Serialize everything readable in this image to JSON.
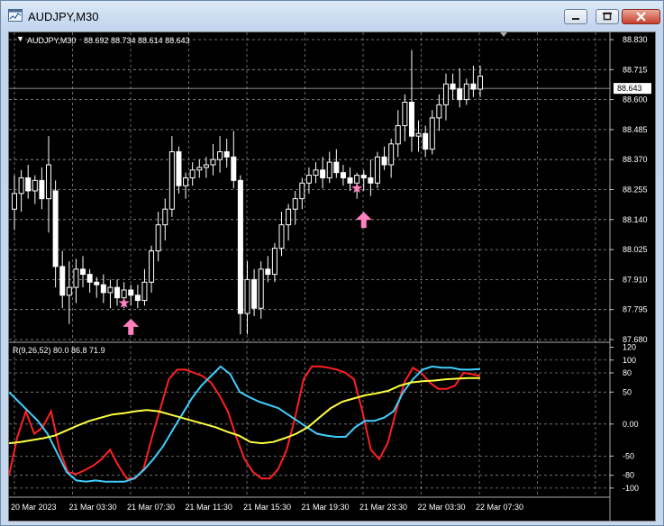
{
  "window": {
    "title": "AUDJPY,M30",
    "icon": "chart-window-icon"
  },
  "controls": {
    "minimize": "minimize-icon",
    "maximize": "maximize-icon",
    "close": "close-icon"
  },
  "chart": {
    "symbol_label": "AUDJPY,M30",
    "ohlc_text": "88.692 88.734 88.614 88.643",
    "current_price": "88.643",
    "price_ticks": [
      "88.830",
      "88.715",
      "88.600",
      "88.485",
      "88.370",
      "88.255",
      "88.140",
      "88.025",
      "87.910",
      "87.795",
      "87.680"
    ],
    "indicator_label": "R(9,26,52) 80.0 86.8 71.9",
    "indicator_ticks": [
      "120",
      "100",
      "80",
      "50",
      "0.00",
      "-50",
      "-80",
      "-100"
    ],
    "time_labels": [
      "20 Mar 2023",
      "21 Mar 03:30",
      "21 Mar 07:30",
      "21 Mar 11:30",
      "21 Mar 15:30",
      "21 Mar 19:30",
      "21 Mar 23:30",
      "22 Mar 03:30",
      "22 Mar 07:30"
    ],
    "colors": {
      "background": "#000000",
      "grid": "#c8c8c8",
      "candle": "#ffffff",
      "candle_body_bull": "#000000",
      "marker": "#ff7fbf",
      "fast_line": "#ff2020",
      "mid_line": "#40d0ff",
      "slow_line": "#ffff40",
      "axis_text": "#ffffff",
      "price_box_bg": "#ffffff",
      "price_box_text": "#000000"
    }
  },
  "chart_data": {
    "type": "candlestick",
    "price_axis_range": [
      87.68,
      88.83
    ],
    "candles": [
      {
        "o": 88.18,
        "h": 88.31,
        "l": 88.1,
        "c": 88.24
      },
      {
        "o": 88.24,
        "h": 88.33,
        "l": 88.17,
        "c": 88.3
      },
      {
        "o": 88.3,
        "h": 88.35,
        "l": 88.22,
        "c": 88.25
      },
      {
        "o": 88.25,
        "h": 88.31,
        "l": 88.2,
        "c": 88.29
      },
      {
        "o": 88.29,
        "h": 88.34,
        "l": 88.18,
        "c": 88.22
      },
      {
        "o": 88.22,
        "h": 88.46,
        "l": 88.09,
        "c": 88.35
      },
      {
        "o": 88.25,
        "h": 88.29,
        "l": 87.88,
        "c": 87.96
      },
      {
        "o": 87.96,
        "h": 88.02,
        "l": 87.8,
        "c": 87.85
      },
      {
        "o": 87.85,
        "h": 87.98,
        "l": 87.74,
        "c": 87.88
      },
      {
        "o": 87.88,
        "h": 87.99,
        "l": 87.82,
        "c": 87.95
      },
      {
        "o": 87.95,
        "h": 88.0,
        "l": 87.88,
        "c": 87.93
      },
      {
        "o": 87.93,
        "h": 87.95,
        "l": 87.86,
        "c": 87.9
      },
      {
        "o": 87.9,
        "h": 87.92,
        "l": 87.84,
        "c": 87.89
      },
      {
        "o": 87.89,
        "h": 87.93,
        "l": 87.82,
        "c": 87.86
      },
      {
        "o": 87.86,
        "h": 87.91,
        "l": 87.8,
        "c": 87.88
      },
      {
        "o": 87.88,
        "h": 87.91,
        "l": 87.81,
        "c": 87.84
      },
      {
        "o": 87.84,
        "h": 87.9,
        "l": 87.8,
        "c": 87.87
      },
      {
        "o": 87.87,
        "h": 87.89,
        "l": 87.81,
        "c": 87.85
      },
      {
        "o": 87.85,
        "h": 87.89,
        "l": 87.8,
        "c": 87.83
      },
      {
        "o": 87.83,
        "h": 87.95,
        "l": 87.81,
        "c": 87.9
      },
      {
        "o": 87.9,
        "h": 88.04,
        "l": 87.86,
        "c": 88.02
      },
      {
        "o": 88.02,
        "h": 88.17,
        "l": 87.98,
        "c": 88.12
      },
      {
        "o": 88.12,
        "h": 88.22,
        "l": 88.06,
        "c": 88.18
      },
      {
        "o": 88.18,
        "h": 88.46,
        "l": 88.15,
        "c": 88.4
      },
      {
        "o": 88.4,
        "h": 88.42,
        "l": 88.24,
        "c": 88.27
      },
      {
        "o": 88.27,
        "h": 88.32,
        "l": 88.22,
        "c": 88.3
      },
      {
        "o": 88.3,
        "h": 88.36,
        "l": 88.27,
        "c": 88.33
      },
      {
        "o": 88.33,
        "h": 88.37,
        "l": 88.3,
        "c": 88.34
      },
      {
        "o": 88.34,
        "h": 88.38,
        "l": 88.3,
        "c": 88.35
      },
      {
        "o": 88.35,
        "h": 88.43,
        "l": 88.31,
        "c": 88.37
      },
      {
        "o": 88.37,
        "h": 88.46,
        "l": 88.32,
        "c": 88.4
      },
      {
        "o": 88.4,
        "h": 88.45,
        "l": 88.34,
        "c": 88.38
      },
      {
        "o": 88.38,
        "h": 88.48,
        "l": 88.26,
        "c": 88.29
      },
      {
        "o": 88.29,
        "h": 88.31,
        "l": 87.7,
        "c": 87.78
      },
      {
        "o": 87.78,
        "h": 87.98,
        "l": 87.7,
        "c": 87.91
      },
      {
        "o": 87.91,
        "h": 87.95,
        "l": 87.77,
        "c": 87.8
      },
      {
        "o": 87.8,
        "h": 87.98,
        "l": 87.76,
        "c": 87.95
      },
      {
        "o": 87.95,
        "h": 88.0,
        "l": 87.9,
        "c": 87.93
      },
      {
        "o": 87.93,
        "h": 88.05,
        "l": 87.9,
        "c": 88.03
      },
      {
        "o": 88.03,
        "h": 88.17,
        "l": 88.0,
        "c": 88.12
      },
      {
        "o": 88.12,
        "h": 88.2,
        "l": 88.06,
        "c": 88.18
      },
      {
        "o": 88.18,
        "h": 88.25,
        "l": 88.12,
        "c": 88.22
      },
      {
        "o": 88.22,
        "h": 88.3,
        "l": 88.18,
        "c": 88.28
      },
      {
        "o": 88.28,
        "h": 88.34,
        "l": 88.24,
        "c": 88.31
      },
      {
        "o": 88.31,
        "h": 88.36,
        "l": 88.28,
        "c": 88.33
      },
      {
        "o": 88.33,
        "h": 88.38,
        "l": 88.26,
        "c": 88.3
      },
      {
        "o": 88.3,
        "h": 88.4,
        "l": 88.28,
        "c": 88.36
      },
      {
        "o": 88.36,
        "h": 88.41,
        "l": 88.3,
        "c": 88.32
      },
      {
        "o": 88.32,
        "h": 88.35,
        "l": 88.27,
        "c": 88.3
      },
      {
        "o": 88.3,
        "h": 88.34,
        "l": 88.25,
        "c": 88.28
      },
      {
        "o": 88.28,
        "h": 88.32,
        "l": 88.22,
        "c": 88.31
      },
      {
        "o": 88.31,
        "h": 88.33,
        "l": 88.25,
        "c": 88.3
      },
      {
        "o": 88.3,
        "h": 88.37,
        "l": 88.23,
        "c": 88.28
      },
      {
        "o": 88.28,
        "h": 88.4,
        "l": 88.26,
        "c": 88.38
      },
      {
        "o": 88.38,
        "h": 88.42,
        "l": 88.33,
        "c": 88.35
      },
      {
        "o": 88.35,
        "h": 88.45,
        "l": 88.3,
        "c": 88.43
      },
      {
        "o": 88.43,
        "h": 88.56,
        "l": 88.38,
        "c": 88.5
      },
      {
        "o": 88.5,
        "h": 88.62,
        "l": 88.44,
        "c": 88.59
      },
      {
        "o": 88.59,
        "h": 88.79,
        "l": 88.4,
        "c": 88.46
      },
      {
        "o": 88.46,
        "h": 88.52,
        "l": 88.4,
        "c": 88.47
      },
      {
        "o": 88.47,
        "h": 88.5,
        "l": 88.38,
        "c": 88.41
      },
      {
        "o": 88.41,
        "h": 88.56,
        "l": 88.39,
        "c": 88.53
      },
      {
        "o": 88.53,
        "h": 88.62,
        "l": 88.48,
        "c": 88.58
      },
      {
        "o": 88.58,
        "h": 88.7,
        "l": 88.52,
        "c": 88.66
      },
      {
        "o": 88.66,
        "h": 88.7,
        "l": 88.6,
        "c": 88.64
      },
      {
        "o": 88.64,
        "h": 88.72,
        "l": 88.57,
        "c": 88.6
      },
      {
        "o": 88.6,
        "h": 88.68,
        "l": 88.58,
        "c": 88.66
      },
      {
        "o": 88.66,
        "h": 88.73,
        "l": 88.61,
        "c": 88.64
      },
      {
        "o": 88.64,
        "h": 88.73,
        "l": 88.61,
        "c": 88.69
      }
    ],
    "arrows": [
      {
        "candle": 17,
        "price": 87.76
      },
      {
        "candle": 51,
        "price": 88.17
      }
    ],
    "stars": [
      {
        "candle": 16,
        "price": 87.82
      },
      {
        "candle": 50,
        "price": 88.26
      }
    ],
    "indicator": {
      "range": [
        -110,
        125
      ],
      "lines": [
        73,
        85,
        63
      ],
      "series": [
        {
          "key": "fast",
          "values": [
            -80,
            -20,
            20,
            -15,
            -5,
            20,
            -40,
            -75,
            -78,
            -72,
            -65,
            -55,
            -40,
            -65,
            -85,
            -85,
            -70,
            -20,
            25,
            70,
            85,
            85,
            80,
            75,
            65,
            45,
            20,
            -20,
            -55,
            -75,
            -85,
            -85,
            -70,
            -40,
            10,
            70,
            90,
            90,
            88,
            85,
            80,
            70,
            20,
            -40,
            -55,
            -30,
            20,
            65,
            88,
            80,
            65,
            55,
            55,
            60,
            80,
            78,
            75
          ]
        },
        {
          "key": "mid",
          "values": [
            50,
            35,
            20,
            5,
            -15,
            -45,
            -75,
            -88,
            -90,
            -88,
            -90,
            -90,
            -90,
            -85,
            -72,
            -55,
            -35,
            -10,
            15,
            40,
            60,
            75,
            90,
            78,
            50,
            42,
            35,
            30,
            25,
            15,
            5,
            -5,
            -15,
            -18,
            -20,
            -20,
            -5,
            5,
            5,
            10,
            20,
            50,
            70,
            85,
            90,
            88,
            88,
            85,
            85,
            86
          ]
        },
        {
          "key": "slow",
          "values": [
            -30,
            -28,
            -25,
            -22,
            -18,
            -10,
            -2,
            5,
            10,
            15,
            17,
            20,
            22,
            20,
            15,
            10,
            5,
            0,
            -5,
            -12,
            -18,
            -28,
            -30,
            -28,
            -22,
            -15,
            -5,
            10,
            25,
            35,
            40,
            45,
            48,
            52,
            60,
            65,
            67,
            68,
            70,
            71,
            72,
            72
          ]
        }
      ]
    }
  }
}
